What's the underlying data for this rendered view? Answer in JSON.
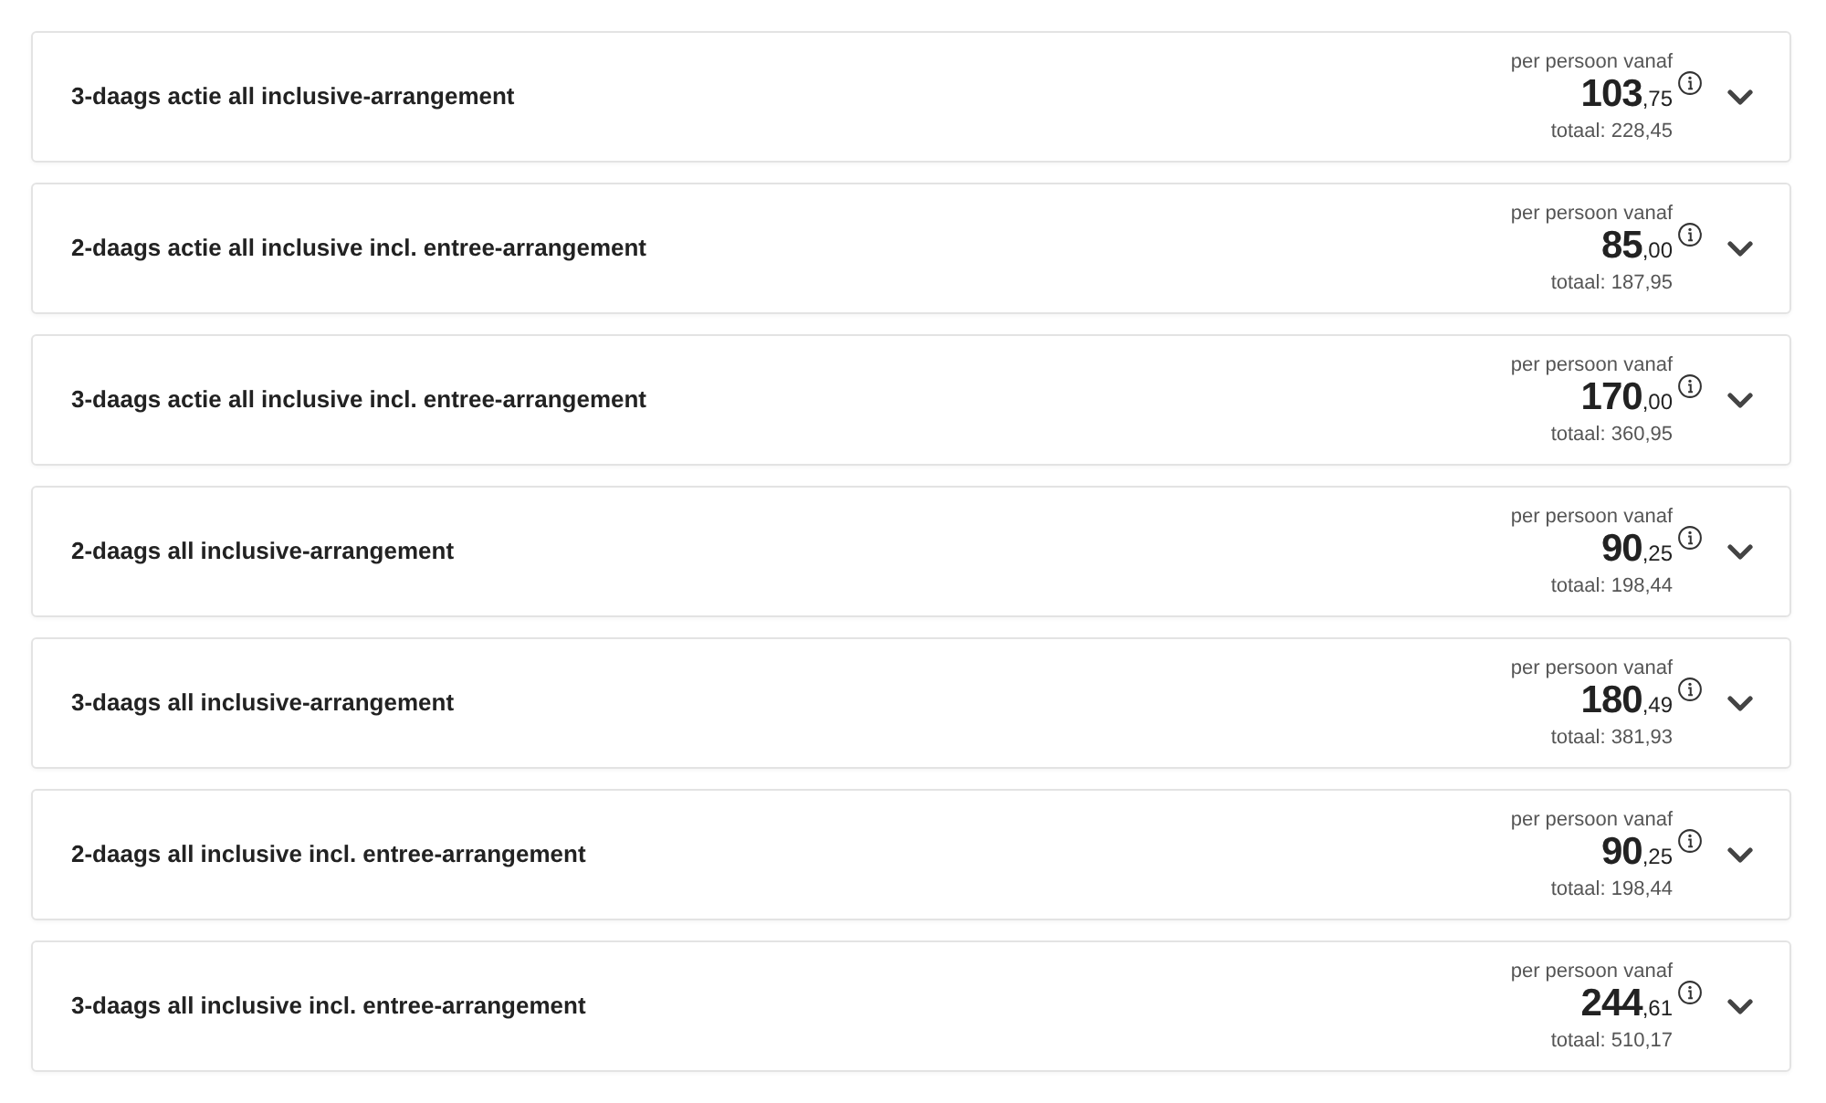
{
  "arrangements": [
    {
      "title": "3-daags actie all inclusive-arrangement",
      "price_label": "per persoon vanaf",
      "price_whole": "103",
      "price_cents": ",75",
      "total": "totaal: 228,45",
      "expanded": false
    },
    {
      "title": "2-daags actie all inclusive incl. entree-arrangement",
      "price_label": "per persoon vanaf",
      "price_whole": "85",
      "price_cents": ",00",
      "total": "totaal: 187,95",
      "expanded": false
    },
    {
      "title": "3-daags actie all inclusive incl. entree-arrangement",
      "price_label": "per persoon vanaf",
      "price_whole": "170",
      "price_cents": ",00",
      "total": "totaal: 360,95",
      "expanded": false
    },
    {
      "title": "2-daags all inclusive-arrangement",
      "price_label": "per persoon vanaf",
      "price_whole": "90",
      "price_cents": ",25",
      "total": "totaal: 198,44",
      "expanded": false
    },
    {
      "title": "3-daags all inclusive-arrangement",
      "price_label": "per persoon vanaf",
      "price_whole": "180",
      "price_cents": ",49",
      "total": "totaal: 381,93",
      "expanded": false
    },
    {
      "title": "2-daags all inclusive incl. entree-arrangement",
      "price_label": "per persoon vanaf",
      "price_whole": "90",
      "price_cents": ",25",
      "total": "totaal: 198,44",
      "expanded": false
    },
    {
      "title": "3-daags all inclusive incl. entree-arrangement",
      "price_label": "per persoon vanaf",
      "price_whole": "244",
      "price_cents": ",61",
      "total": "totaal: 510,17",
      "expanded": false
    }
  ]
}
